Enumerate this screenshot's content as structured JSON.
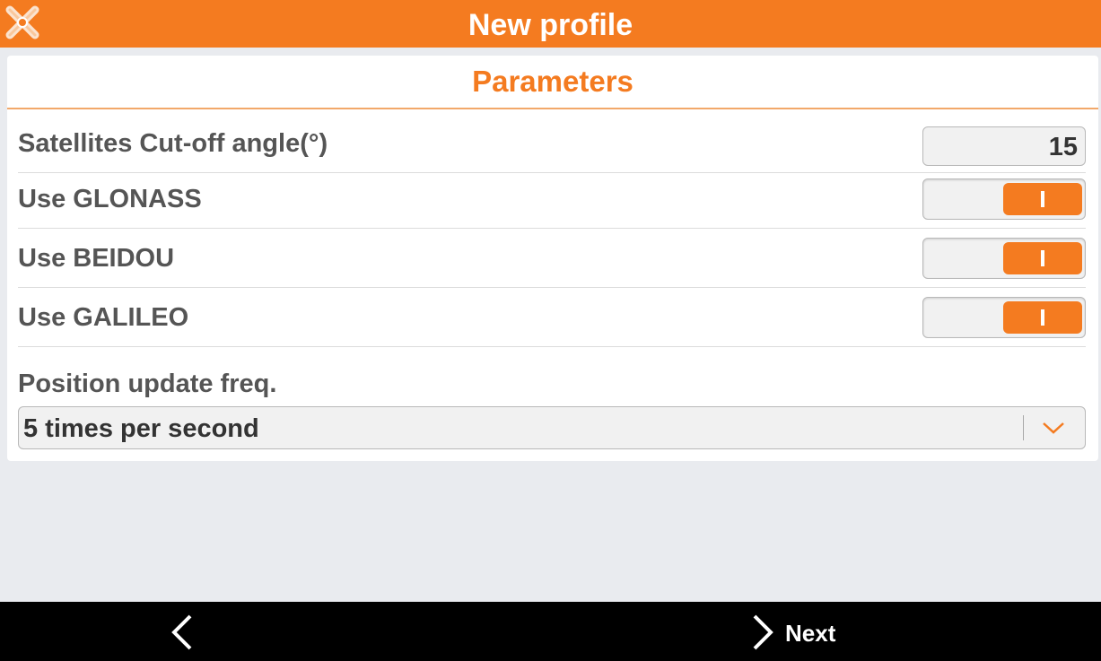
{
  "header": {
    "title": "New profile"
  },
  "card": {
    "title": "Parameters",
    "cutoff": {
      "label": "Satellites Cut-off angle(°)",
      "value": "15"
    },
    "toggles": [
      {
        "label": "Use GLONASS",
        "on": true
      },
      {
        "label": "Use BEIDOU",
        "on": true
      },
      {
        "label": "Use GALILEO",
        "on": true
      }
    ],
    "frequency": {
      "label": "Position update freq.",
      "selected": "5 times per second"
    }
  },
  "footer": {
    "back_icon": "chevron-left-icon",
    "next_label": "Next"
  },
  "colors": {
    "accent": "#f47b20",
    "background": "#e9ebef",
    "footer": "#000000"
  }
}
